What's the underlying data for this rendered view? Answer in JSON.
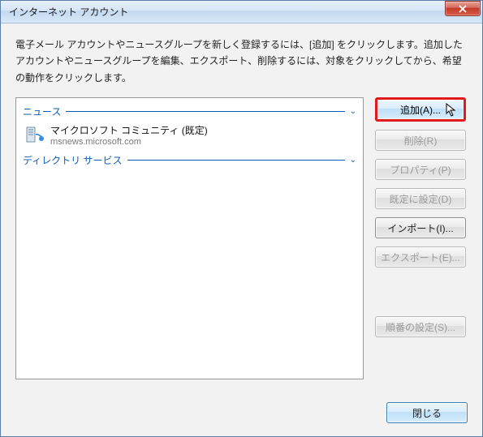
{
  "window": {
    "title": "インターネット アカウント"
  },
  "instruction": "電子メール アカウントやニュースグループを新しく登録するには、[追加] をクリックします。追加したアカウントやニュースグループを編集、エクスポート、削除するには、対象をクリックしてから、希望の動作をクリックします。",
  "sections": {
    "news": {
      "label": "ニュース"
    },
    "directory": {
      "label": "ディレクトリ サービス"
    }
  },
  "account": {
    "name": "マイクロソフト コミュニティ (既定)",
    "sub": "msnews.microsoft.com"
  },
  "buttons": {
    "add": "追加(A)...",
    "remove": "削除(R)",
    "properties": "プロパティ(P)",
    "setdefault": "既定に設定(D)",
    "import": "インポート(I)...",
    "export": "エクスポート(E)...",
    "setorder": "順番の設定(S)...",
    "close": "閉じる"
  }
}
